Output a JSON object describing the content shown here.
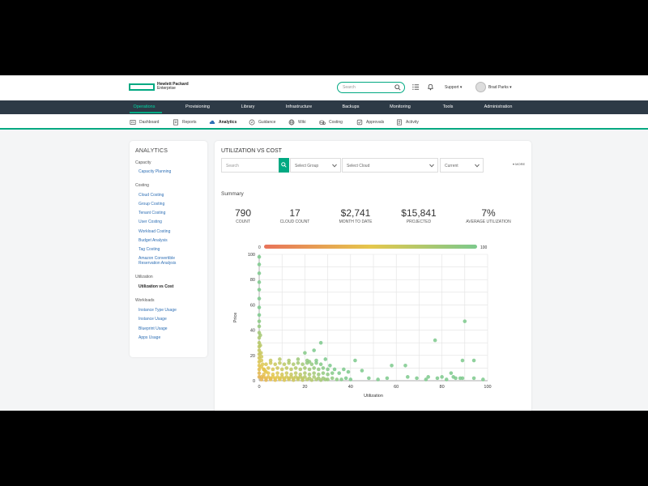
{
  "header": {
    "logo_line1": "Hewlett Packard",
    "logo_line2": "Enterprise",
    "search_placeholder": "Search",
    "support_label": "Support ▾",
    "user_label": "Brad Parks ▾"
  },
  "main_nav": [
    {
      "label": "Operations",
      "active": true
    },
    {
      "label": "Provisioning"
    },
    {
      "label": "Library"
    },
    {
      "label": "Infrastructure"
    },
    {
      "label": "Backups"
    },
    {
      "label": "Monitoring"
    },
    {
      "label": "Tools"
    },
    {
      "label": "Administration"
    }
  ],
  "sub_nav": [
    {
      "label": "Dashboard",
      "icon": "dashboard-icon"
    },
    {
      "label": "Reports",
      "icon": "reports-icon"
    },
    {
      "label": "Analytics",
      "icon": "cloud-icon",
      "active": true
    },
    {
      "label": "Guidance",
      "icon": "compass-icon"
    },
    {
      "label": "Wiki",
      "icon": "globe-icon"
    },
    {
      "label": "Costing",
      "icon": "coins-icon"
    },
    {
      "label": "Approvals",
      "icon": "check-icon"
    },
    {
      "label": "Activity",
      "icon": "activity-icon"
    }
  ],
  "sidebar": {
    "title": "ANALYTICS",
    "sections": [
      {
        "title": "Capacity",
        "links": [
          "Capacity Planning"
        ]
      },
      {
        "title": "Costing",
        "links": [
          "Cloud Costing",
          "Group Costing",
          "Tenant Costing",
          "User Costing",
          "Workload Costing",
          "Budget Analysis",
          "Tag Costing",
          "Amazon Convertible\nReservation Analysis"
        ]
      },
      {
        "title": "Utilization",
        "links": [
          "Utilization vs Cost"
        ],
        "active": 0
      },
      {
        "title": "Workloads",
        "links": [
          "Instance Type Usage",
          "Instance Usage",
          "Blueprint Usage",
          "Apps Usage"
        ]
      }
    ]
  },
  "content": {
    "title": "UTILIZATION VS COST",
    "filters": {
      "search_placeholder": "Search",
      "group": "Select Group",
      "cloud": "Select Cloud",
      "period": "Current"
    },
    "more_label": "▾ MORE",
    "summary_label": "Summary",
    "stats": [
      {
        "value": "790",
        "label": "COUNT"
      },
      {
        "value": "17",
        "label": "CLOUD COUNT"
      },
      {
        "value": "$2,741",
        "label": "MONTH TO DATE"
      },
      {
        "value": "$15,841",
        "label": "PROJECTED"
      },
      {
        "value": "7%",
        "label": "AVERAGE UTILIZATION"
      }
    ]
  },
  "colors": {
    "accent": "#01a982",
    "nav_bg": "#2d3a46",
    "link": "#2e6fb5",
    "gradient_low": "#e8735a",
    "gradient_mid": "#e5c74c",
    "gradient_high": "#7cc98c"
  },
  "chart_data": {
    "type": "scatter",
    "xlabel": "Utilization",
    "ylabel": "Price",
    "xlim": [
      0,
      100
    ],
    "ylim": [
      0,
      100
    ],
    "x_ticks": [
      0,
      20,
      40,
      60,
      80,
      100
    ],
    "y_ticks": [
      0,
      20,
      40,
      60,
      80,
      100
    ],
    "grid": true,
    "color_scale": {
      "min_label": "0",
      "max_label": "100"
    },
    "points": [
      [
        0,
        98
      ],
      [
        0,
        92
      ],
      [
        0,
        85
      ],
      [
        0,
        78
      ],
      [
        0,
        72
      ],
      [
        0,
        65
      ],
      [
        0,
        58
      ],
      [
        0,
        52
      ],
      [
        0,
        47
      ],
      [
        0,
        43
      ],
      [
        0,
        38
      ],
      [
        0,
        34
      ],
      [
        0,
        30
      ],
      [
        0,
        27
      ],
      [
        0,
        24
      ],
      [
        0,
        21
      ],
      [
        0,
        18
      ],
      [
        0,
        15
      ],
      [
        0,
        12
      ],
      [
        0,
        9
      ],
      [
        0,
        6
      ],
      [
        0,
        3
      ],
      [
        0.5,
        36
      ],
      [
        0.5,
        28
      ],
      [
        0.8,
        22
      ],
      [
        1,
        19
      ],
      [
        1,
        16
      ],
      [
        1.5,
        13
      ],
      [
        1,
        11
      ],
      [
        2,
        9
      ],
      [
        2.5,
        8
      ],
      [
        3,
        7
      ],
      [
        1,
        3
      ],
      [
        2,
        3
      ],
      [
        3,
        2
      ],
      [
        4,
        3
      ],
      [
        5,
        2
      ],
      [
        6,
        3
      ],
      [
        7,
        2
      ],
      [
        8,
        3
      ],
      [
        9,
        2
      ],
      [
        10,
        3
      ],
      [
        11,
        2
      ],
      [
        12,
        3
      ],
      [
        13,
        2
      ],
      [
        14,
        3
      ],
      [
        15,
        2
      ],
      [
        16,
        3
      ],
      [
        17,
        2
      ],
      [
        18,
        3
      ],
      [
        19,
        2
      ],
      [
        20,
        3
      ],
      [
        22,
        2
      ],
      [
        24,
        3
      ],
      [
        26,
        2
      ],
      [
        28,
        2
      ],
      [
        30,
        1
      ],
      [
        32,
        2
      ],
      [
        34,
        1
      ],
      [
        36,
        1
      ],
      [
        38,
        2
      ],
      [
        40,
        1
      ],
      [
        1,
        1
      ],
      [
        3,
        0.5
      ],
      [
        5,
        1
      ],
      [
        7,
        0.5
      ],
      [
        9,
        1
      ],
      [
        11,
        0.5
      ],
      [
        13,
        1
      ],
      [
        15,
        0.5
      ],
      [
        17,
        1
      ],
      [
        19,
        0.5
      ],
      [
        21,
        1
      ],
      [
        23,
        0.5
      ],
      [
        25,
        1
      ],
      [
        27,
        0.5
      ],
      [
        29,
        1
      ],
      [
        2,
        5
      ],
      [
        4,
        6
      ],
      [
        6,
        5
      ],
      [
        8,
        6
      ],
      [
        10,
        5
      ],
      [
        12,
        6
      ],
      [
        14,
        5
      ],
      [
        16,
        6
      ],
      [
        18,
        5
      ],
      [
        20,
        6
      ],
      [
        22,
        5
      ],
      [
        24,
        6
      ],
      [
        26,
        5
      ],
      [
        28,
        6
      ],
      [
        30,
        5
      ],
      [
        32,
        6
      ],
      [
        2,
        9
      ],
      [
        4,
        10
      ],
      [
        6,
        9
      ],
      [
        8,
        10
      ],
      [
        10,
        9
      ],
      [
        12,
        10
      ],
      [
        14,
        9
      ],
      [
        16,
        10
      ],
      [
        18,
        9
      ],
      [
        20,
        10
      ],
      [
        22,
        9
      ],
      [
        24,
        10
      ],
      [
        26,
        9
      ],
      [
        28,
        10
      ],
      [
        30,
        9
      ],
      [
        3,
        13
      ],
      [
        5,
        14
      ],
      [
        7,
        13
      ],
      [
        9,
        14
      ],
      [
        11,
        13
      ],
      [
        13,
        14
      ],
      [
        15,
        13
      ],
      [
        17,
        14
      ],
      [
        19,
        13
      ],
      [
        21,
        14
      ],
      [
        23,
        13
      ],
      [
        25,
        14
      ],
      [
        27,
        13
      ],
      [
        5,
        16
      ],
      [
        9,
        17
      ],
      [
        13,
        16
      ],
      [
        17,
        17
      ],
      [
        21,
        16
      ],
      [
        25,
        16
      ],
      [
        29,
        17
      ],
      [
        20,
        22
      ],
      [
        24,
        24
      ],
      [
        27,
        30
      ],
      [
        22,
        15
      ],
      [
        31,
        12
      ],
      [
        33,
        9
      ],
      [
        35,
        6
      ],
      [
        37,
        9
      ],
      [
        39,
        7
      ],
      [
        42,
        16
      ],
      [
        45,
        8
      ],
      [
        48,
        2
      ],
      [
        52,
        1
      ],
      [
        56,
        2
      ],
      [
        58,
        12
      ],
      [
        64,
        12
      ],
      [
        65,
        3
      ],
      [
        69,
        2
      ],
      [
        73,
        1
      ],
      [
        74,
        3
      ],
      [
        77,
        32
      ],
      [
        78,
        2
      ],
      [
        80,
        3
      ],
      [
        82,
        1
      ],
      [
        85,
        3
      ],
      [
        84,
        6
      ],
      [
        86,
        2
      ],
      [
        88,
        2
      ],
      [
        89,
        2
      ],
      [
        89,
        16
      ],
      [
        90,
        47
      ],
      [
        94,
        16
      ],
      [
        94,
        2
      ],
      [
        98,
        1
      ]
    ]
  }
}
